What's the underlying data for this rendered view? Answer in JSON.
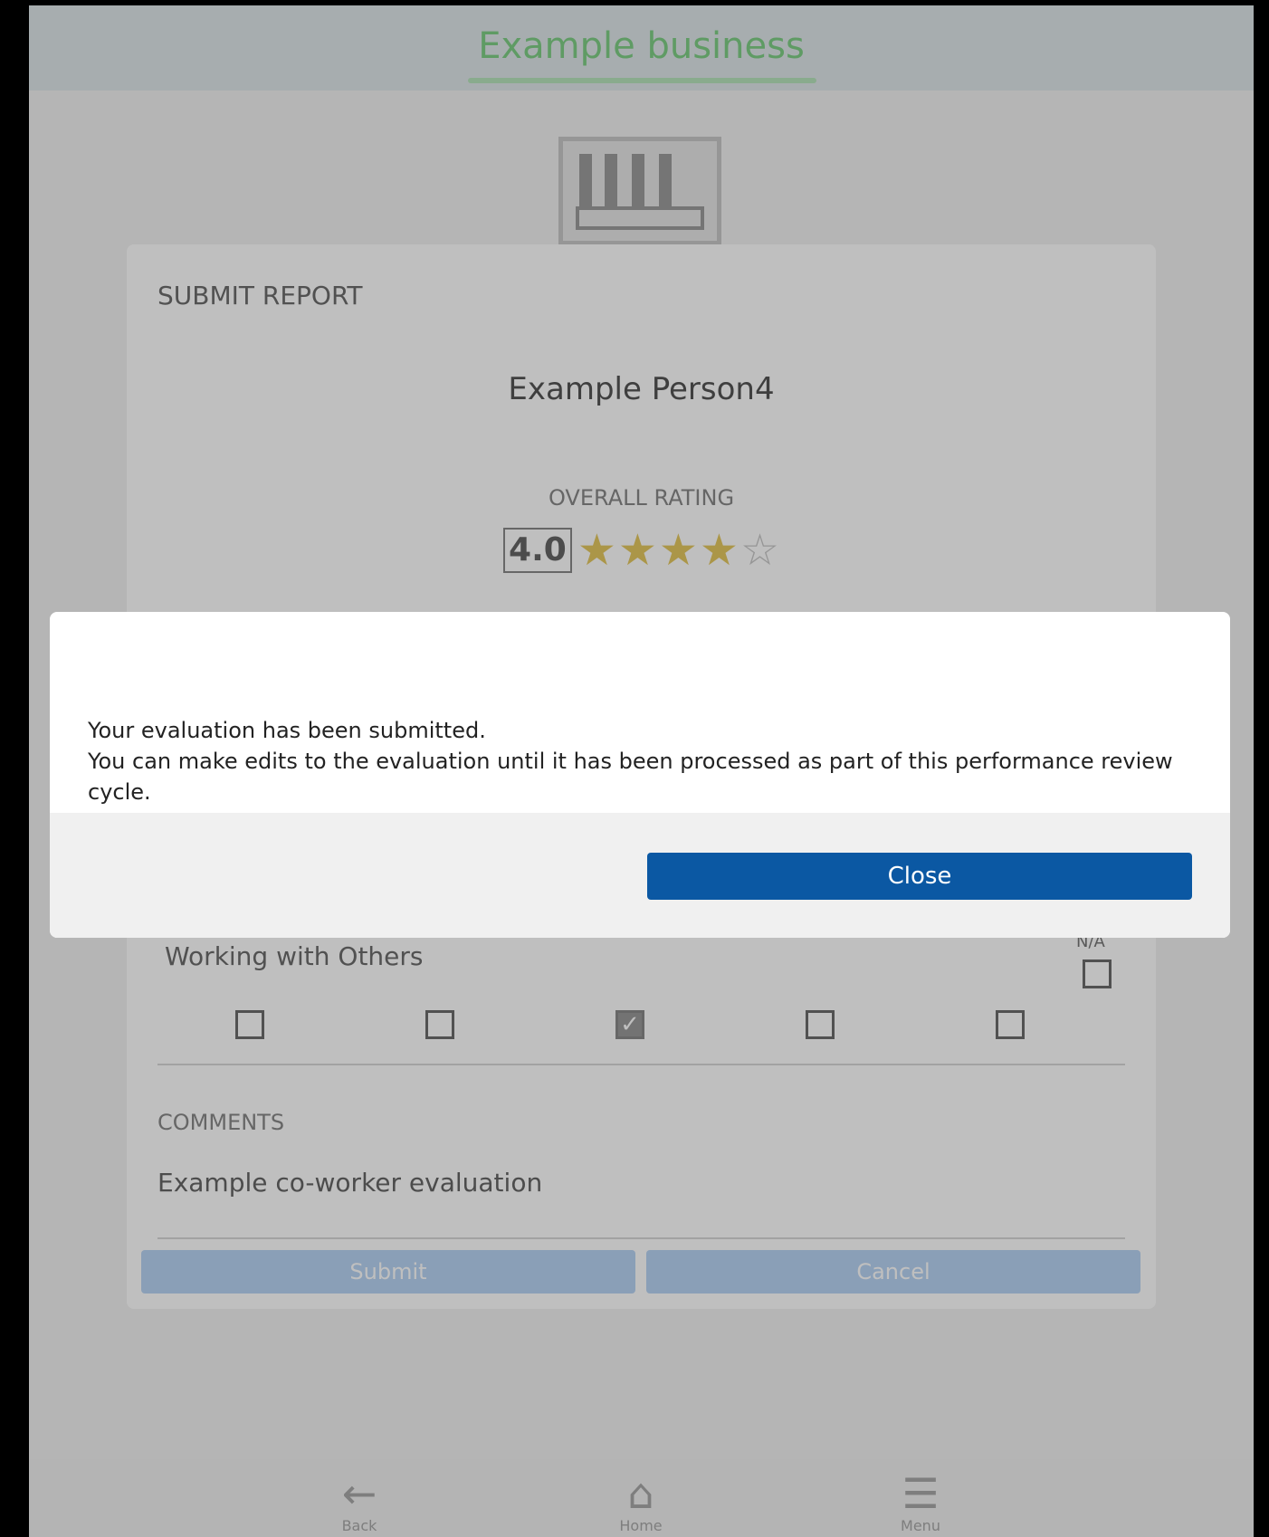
{
  "app": {
    "title": "Example business"
  },
  "report": {
    "title": "SUBMIT REPORT",
    "person": "Example Person4",
    "rating_label": "OVERALL RATING",
    "rating_value": "4.0",
    "stars_filled": 4,
    "stars_total": 5
  },
  "criteria": {
    "label": "Working with Others",
    "na_label": "N/A",
    "selected_option": 3,
    "option_count": 5
  },
  "comments": {
    "label": "COMMENTS",
    "value": "Example co-worker evaluation"
  },
  "buttons": {
    "submit": "Submit",
    "cancel": "Cancel"
  },
  "bottom_nav": {
    "back": "Back",
    "back_icon": "arrow-left-icon",
    "home": "Home",
    "home_icon": "home-icon",
    "menu": "Menu",
    "menu_icon": "hamburger-icon"
  },
  "dialog": {
    "line1": "Your evaluation has been submitted.",
    "line2": "You can make edits to the evaluation until it has been processed as part of this performance review cycle.",
    "close_label": "Close"
  },
  "colors": {
    "accent": "#0b58a3",
    "brand_green": "#7fcf86",
    "star": "#e4c860"
  }
}
